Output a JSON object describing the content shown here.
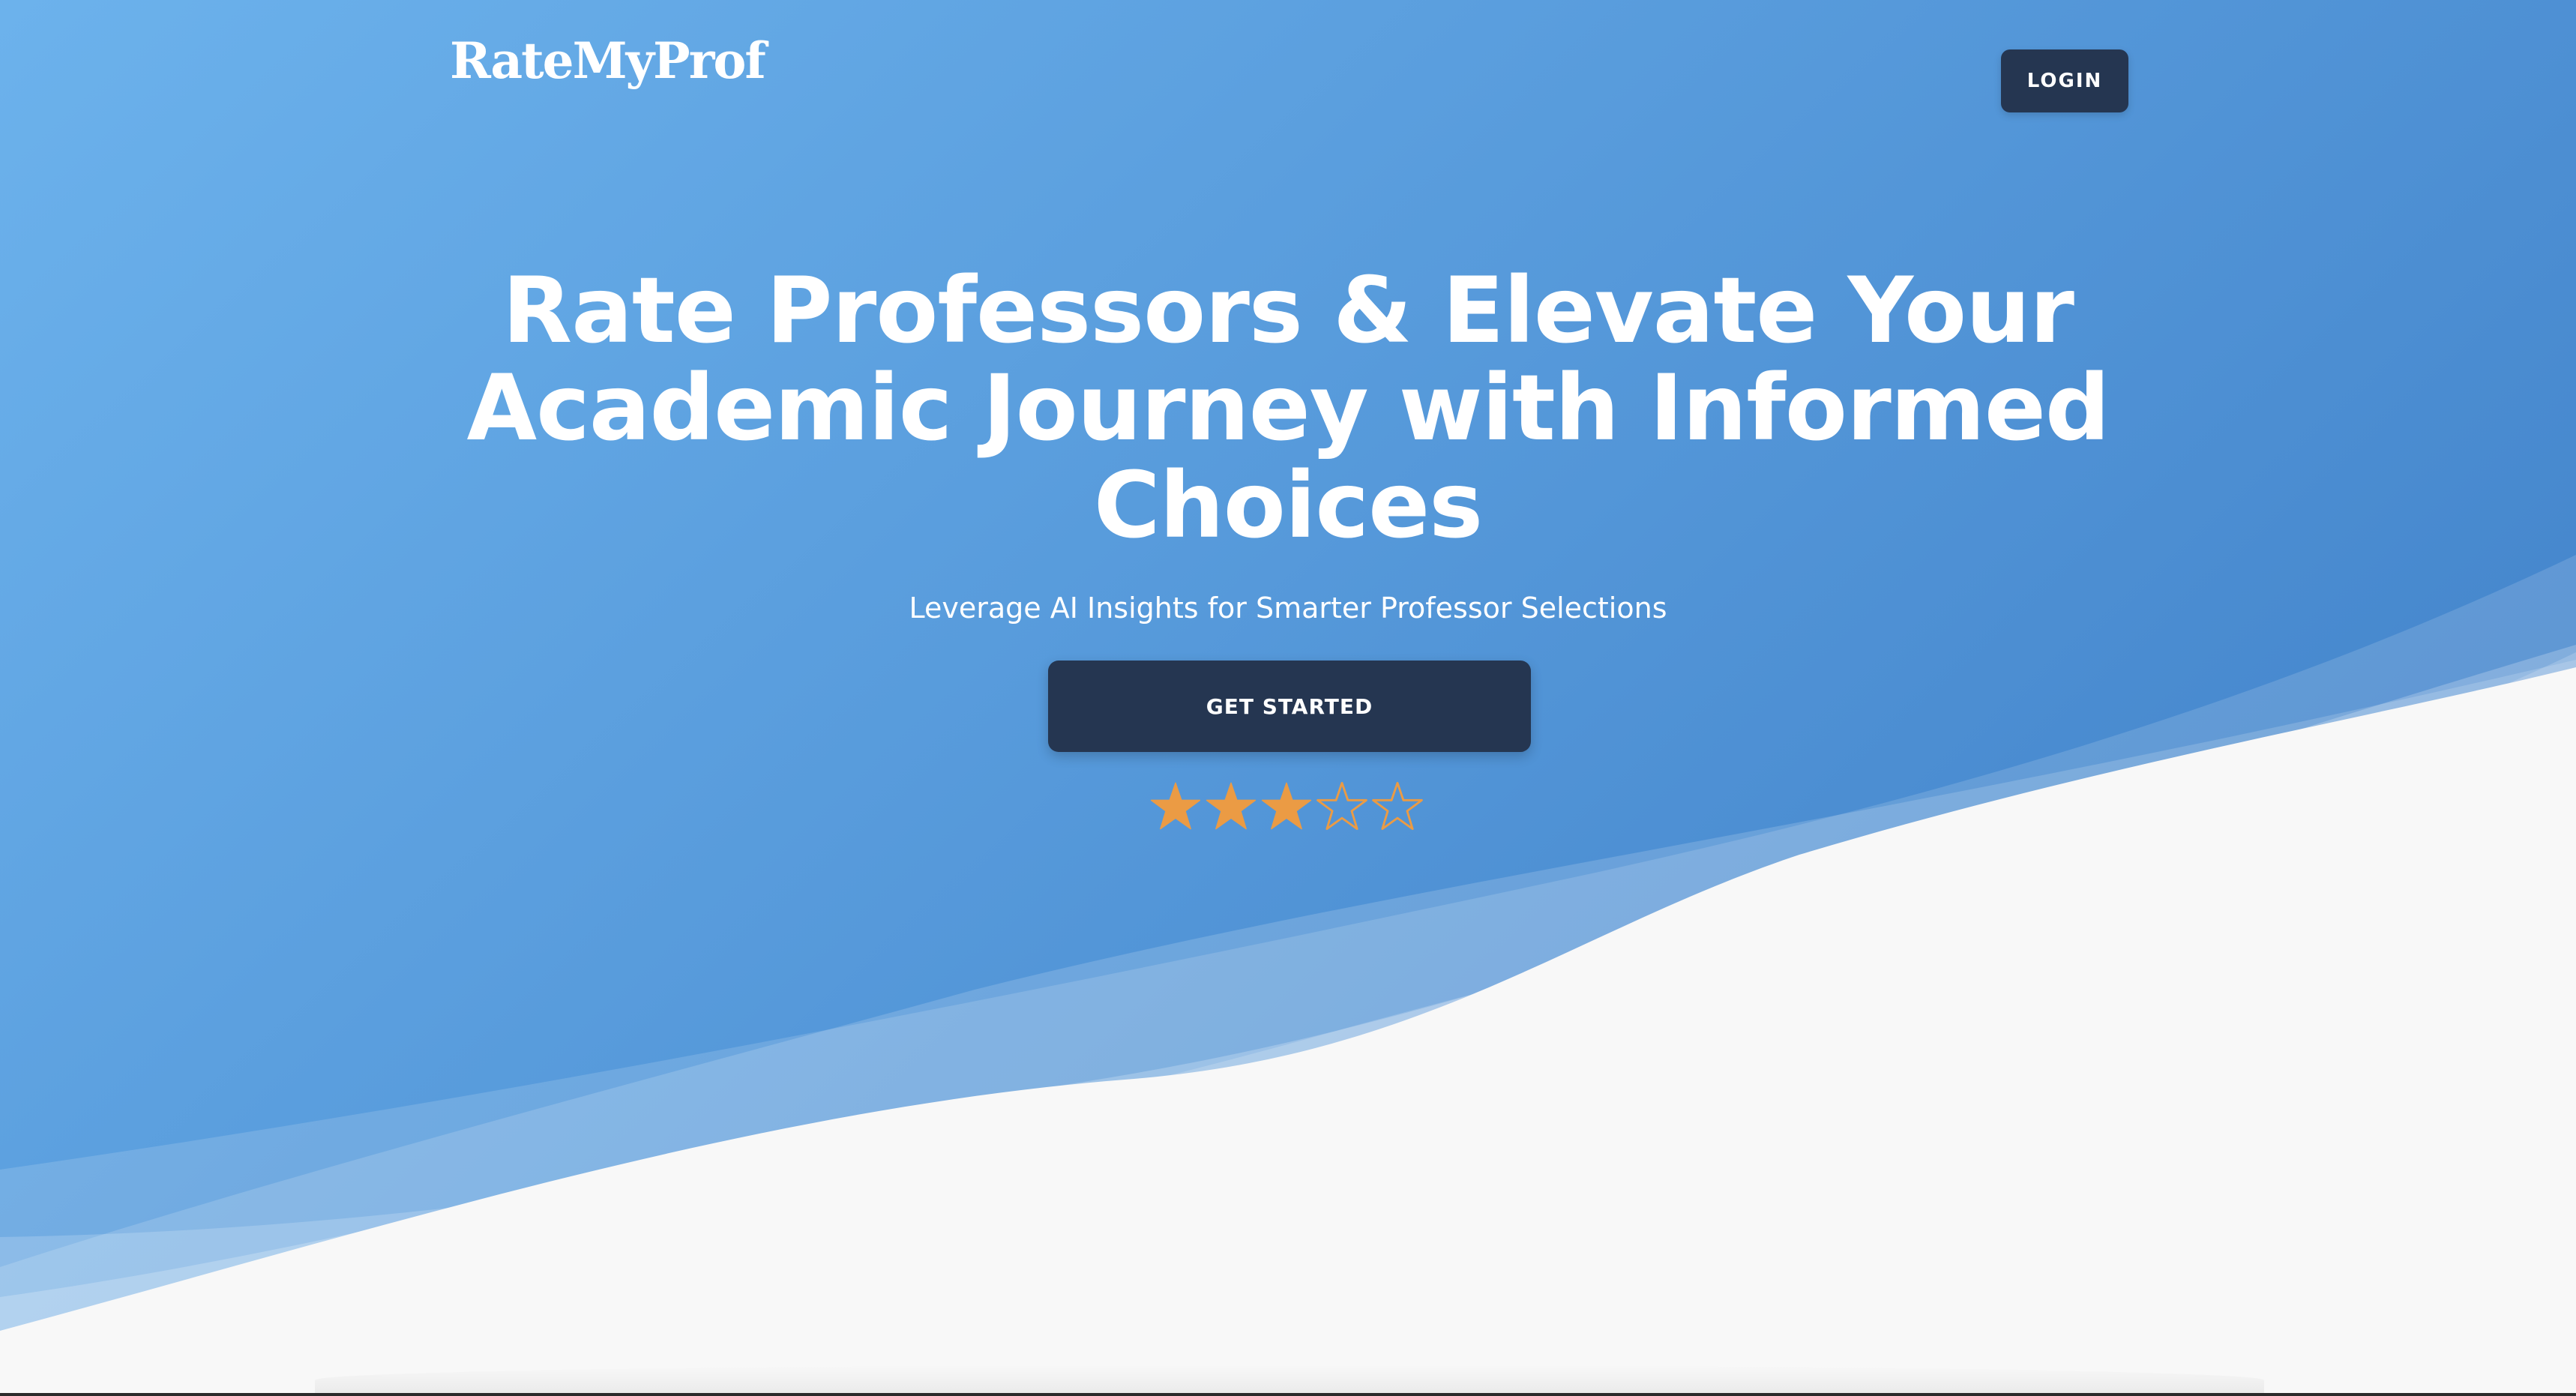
{
  "header": {
    "logo_text": "RateMyProf",
    "login_label": "LOGIN"
  },
  "hero": {
    "headline": "Rate Professors & Elevate Your Academic Journey with Informed Choices",
    "subtitle": "Leverage AI Insights for Smarter Professor Selections",
    "cta_label": "GET STARTED",
    "rating": {
      "filled": 3,
      "total": 5
    }
  },
  "colors": {
    "gradient_start": "#6cb2ec",
    "gradient_end": "#4384cb",
    "button_bg": "#253651",
    "star": "#eb9b44",
    "white_section": "#f8f8f8"
  }
}
